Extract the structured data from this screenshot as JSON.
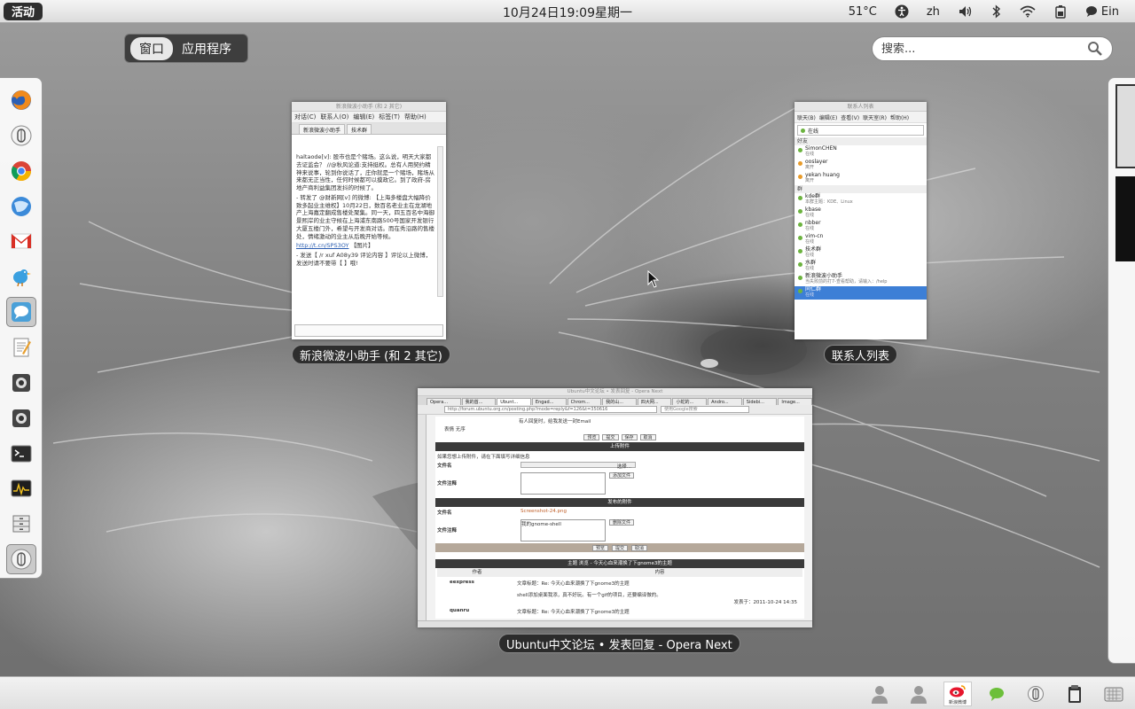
{
  "top_panel": {
    "activities_label": "活动",
    "clock": "10月24日19:09星期一",
    "temperature": "51°C",
    "input_method": "zh",
    "user_label": "Ein",
    "icons": [
      "accessibility-icon",
      "volume-icon",
      "bluetooth-icon",
      "wifi-icon",
      "battery-icon",
      "chat-status-icon"
    ]
  },
  "overview": {
    "view_windows": "窗口",
    "view_applications": "应用程序",
    "search_placeholder": "搜索..."
  },
  "dash": {
    "items": [
      {
        "name": "firefox-icon"
      },
      {
        "name": "pidgin-icon"
      },
      {
        "name": "chrome-icon"
      },
      {
        "name": "thunderbird-icon"
      },
      {
        "name": "gmail-icon"
      },
      {
        "name": "twitter-bird-icon"
      },
      {
        "name": "chat-bubble-icon",
        "running": true
      },
      {
        "name": "text-editor-icon"
      },
      {
        "name": "webcam-icon"
      },
      {
        "name": "webcam-icon-2"
      },
      {
        "name": "terminal-icon"
      },
      {
        "name": "system-monitor-icon"
      },
      {
        "name": "file-cabinet-icon"
      },
      {
        "name": "pidgin-icon-2",
        "running": true
      }
    ]
  },
  "windows": {
    "weibo": {
      "caption": "新浪微波小助手 (和 2 其它)",
      "title": "新浪微波小助手 (和 2 其它)",
      "menu": [
        "对话(C)",
        "联系人(O)",
        "编辑(E)",
        "标签(T)",
        "帮助(H)"
      ],
      "tabs": [
        "新浪微波小助手",
        "技术群"
      ],
      "messages": [
        "haltaode[v]: 股市也是个赌场。这么说，明天大家都去证监会？ //@秋风论道:支持挺权。总有人用契约精神来说事，轮到你说话了，庄你就是一个赌场，赌场从来都无正当性，任何时候都可以摸政它。到了政府-房地产商利益集团发抖的时候了。",
        "- 转发了 @财新网[v] 的微博: 【上海多楼盘大幅降价致多起业主维权】10月22日，数百名老业主在龙湖地产上海嘉定翻成售楼处聚集。同一天，四五百名中海御景熙岸的业主守候在上海浦东南路500号国家开发银行大厦五楼门外，希望与开发商对话。而在秀沿路的售楼处，情绪激动的业主从后晚开始等候。",
        "http://t.cn/SPS3OY",
        "【图片】",
        "- 发送【 /r xuf A08y39 评论内容 】评论以上微博，发送时请不要带【 】哦!"
      ]
    },
    "contacts": {
      "caption": "联系人列表",
      "title": "联系人列表",
      "menu": [
        "联天(B)",
        "编辑(E)",
        "查看(V)",
        "联天室(R)",
        "帮助(H)"
      ],
      "status": "在线",
      "group_friends": "好友",
      "group_groups": "群",
      "friends": [
        {
          "name": "SimonCHEN",
          "status": "在线"
        },
        {
          "name": "ooslayer",
          "status": "离开"
        },
        {
          "name": "yekan huang",
          "status": "离开"
        }
      ],
      "groups": [
        {
          "name": "kde群",
          "status": "本群主题：KDE、Linux"
        },
        {
          "name": "kbase",
          "status": "在线"
        },
        {
          "name": "nbber",
          "status": "在线"
        },
        {
          "name": "vim-cn",
          "status": "在线"
        },
        {
          "name": "技术群",
          "status": "在线"
        },
        {
          "name": "水群",
          "status": "在线"
        },
        {
          "name": "新浪微波小助手",
          "status": "当失败前的打7-查看帮助，请输入：/help"
        },
        {
          "name": "同仁群",
          "status": "在线",
          "selected": true
        }
      ]
    },
    "opera": {
      "caption": "Ubuntu中文论坛 • 发表回复 - Opera Next",
      "title": "Ubuntu中文论坛 • 发表回复 - Opera Next",
      "tabs": [
        "Opera...",
        "我的首...",
        "Ubunt...",
        "Engad...",
        "Chrom...",
        "我的山...",
        "四大网...",
        "小蛇的...",
        "Andro...",
        "Sidebi...",
        "Image..."
      ],
      "url": "http://forum.ubuntu.org.cn/posting.php?mode=reply&f=126&t=350616",
      "search_placeholder": "使用Google搜索",
      "page": {
        "notify": "有人回复时，给我发送一封Email",
        "emoji_label": "表情 无序",
        "buttons": [
          "预览",
          "提交",
          "保存",
          "取消"
        ],
        "upload_header": "上传附件",
        "upload_hint": "如果您想上传附件，请在下面填写详细信息",
        "filename_label": "文件名",
        "comment_label": "文件注释",
        "choose_btn": "选择...",
        "add_file_btn": "添加文件",
        "posted_header": "发布的附件",
        "attached_file": "Screenshot-24.png",
        "attached_comment": "我的gnome-shell",
        "delete_file_btn": "删除文件",
        "bottom_buttons": [
          "预览",
          "提交",
          "取消"
        ],
        "topic_header": "主题 浏览 - 今天心血来潮换了下gnome3的主题",
        "col_author": "作者",
        "col_content": "内容",
        "posts": [
          {
            "author": "eexpress",
            "title": "文章标题：Re: 今天心血来潮换了下gnome3的主题",
            "body": "shell添加桌面我添，真不好玩。有一个gif的项目，还要编译做的。",
            "time": "发表于：2011-10-24 14:35"
          },
          {
            "author": "quanru",
            "title": "文章标题：Re: 今天心血来潮换了下gnome3的主题",
            "body": "",
            "time": ""
          }
        ]
      }
    }
  },
  "tray": {
    "items": [
      "user-icon",
      "user-icon-2",
      "weibo-icon",
      "chat-bubble-icon",
      "pidgin-icon",
      "clipboard-icon",
      "keyboard-icon"
    ],
    "weibo_label": "新浪微博"
  }
}
